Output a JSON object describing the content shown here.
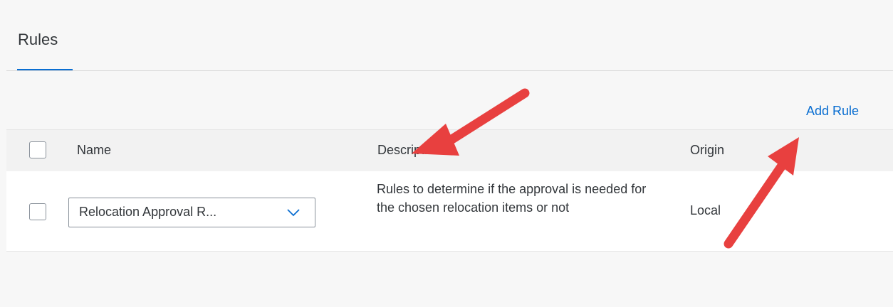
{
  "tabs": {
    "active_label": "Rules"
  },
  "toolbar": {
    "add_rule_label": "Add Rule"
  },
  "table": {
    "headers": {
      "name": "Name",
      "description": "Description",
      "origin": "Origin"
    },
    "rows": [
      {
        "name": "Relocation Approval R...",
        "description": "Rules to determine if the approval is needed for the chosen relocation items or not",
        "origin": "Local"
      }
    ]
  },
  "colors": {
    "accent": "#0a6ed1",
    "annotation_arrow": "#e8403f",
    "background": "#f7f7f7",
    "header_background": "#f2f2f2"
  },
  "icons": {
    "dropdown": "chevron-down-icon",
    "annotation": "arrow-annotation"
  }
}
